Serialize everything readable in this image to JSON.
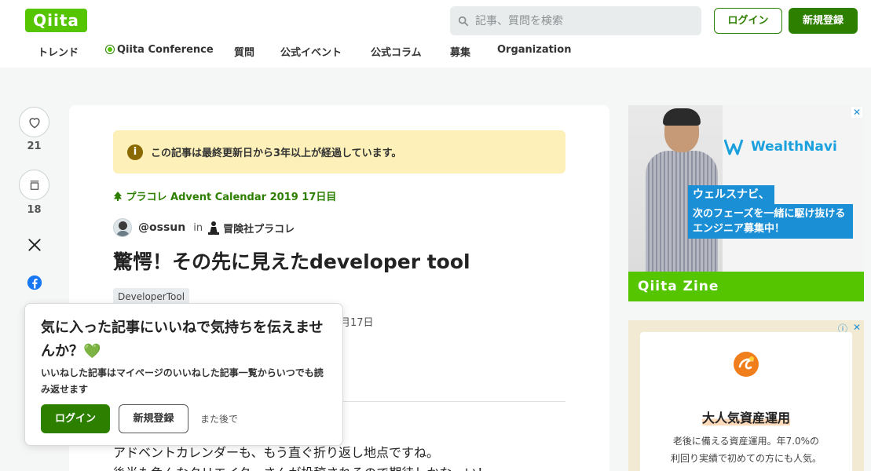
{
  "header": {
    "logo": "Qiita",
    "search_placeholder": "記事、質問を検索",
    "login_label": "ログイン",
    "signup_label": "新規登録"
  },
  "nav": {
    "items": [
      "トレンド",
      "Qiita Conference",
      "質問",
      "公式イベント",
      "公式コラム",
      "募集",
      "Organization"
    ]
  },
  "actions": {
    "like_count": "21",
    "stock_count": "18"
  },
  "article": {
    "notice": "この記事は最終更新日から3年以上が経過しています。",
    "advent": "プラコレ Advent Calendar 2019 17日目",
    "author": "@ossun",
    "in_label": "in",
    "organization": "冒険社プラコレ",
    "title": "驚愕！その先に見えたdeveloper tool",
    "tag": "DeveloperTool",
    "date_fragment": "月17日",
    "body_line1": "アドベントカレンダーも、もう直ぐ折り返し地点ですね。",
    "body_line2": "後半も色んなクリエイターさんが投稿されるので期待しかなーい！"
  },
  "popup": {
    "title": "気に入った記事にいいねで気持ちを伝えませんか？💚",
    "description": "いいねした記事はマイページのいいねした記事一覧からいつでも読み返せます",
    "login_label": "ログイン",
    "signup_label": "新規登録",
    "later_label": "また後で"
  },
  "ads": {
    "ad1": {
      "brand": "WealthNavi",
      "tag": "ウェルスナビ、",
      "copy": "次のフェーズを一緒に駆け抜けるエンジニア募集中！",
      "footer": "Qiita Zine",
      "close": "✕"
    },
    "ad2": {
      "title": "大人気資産運用",
      "text_line1": "老後に備える資産運用。年7.0%の",
      "text_line2": "利回り実績で初めての方にも人気。",
      "info": "ⓘ",
      "close": "✕"
    }
  },
  "colors": {
    "brand_green": "#55c500",
    "dark_green": "#2d7f00",
    "notice_bg": "#fdf0b8",
    "ad_blue": "#1a8fd6"
  }
}
